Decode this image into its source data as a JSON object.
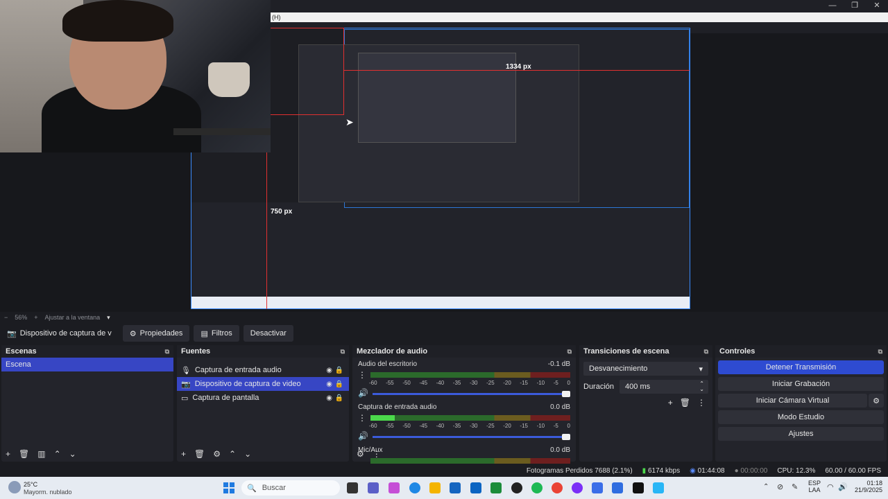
{
  "window": {
    "title_fragment": "(H)",
    "controls": [
      "—",
      "❐",
      "✕"
    ]
  },
  "preview": {
    "measure_h": "1334 px",
    "measure_v": "750 px"
  },
  "zoom": {
    "minus": "−",
    "percent": "56%",
    "plus": "+",
    "fit_label": "Ajustar a la ventana",
    "dropdown": "▾"
  },
  "source_toolbar": {
    "source_name": "Dispositivo de captura de v",
    "properties": "Propiedades",
    "filters": "Filtros",
    "deactivate": "Desactivar"
  },
  "scenes": {
    "title": "Escenas",
    "items": [
      "Escena"
    ]
  },
  "sources": {
    "title": "Fuentes",
    "items": [
      {
        "label": "Captura de entrada audio",
        "icon": "mic-icon"
      },
      {
        "label": "Dispositivo de captura de video",
        "icon": "camera-icon"
      },
      {
        "label": "Captura de pantalla",
        "icon": "monitor-icon"
      }
    ]
  },
  "mixer": {
    "title": "Mezclador de audio",
    "channels": [
      {
        "name": "Audio del escritorio",
        "db": "-0.1 dB",
        "level": 0
      },
      {
        "name": "Captura de entrada audio",
        "db": "0.0 dB",
        "level": 0.12
      },
      {
        "name": "Mic/Aux",
        "db": "0.0 dB",
        "level": 0
      }
    ],
    "scale": [
      "-60",
      "-55",
      "-50",
      "-45",
      "-40",
      "-35",
      "-30",
      "-25",
      "-20",
      "-15",
      "-10",
      "-5",
      "0"
    ]
  },
  "transitions": {
    "title": "Transiciones de escena",
    "selected": "Desvanecimiento",
    "duration_label": "Duración",
    "duration_value": "400 ms"
  },
  "controls": {
    "title": "Controles",
    "stop_stream": "Detener Transmisión",
    "start_recording": "Iniciar Grabación",
    "start_virtual_cam": "Iniciar Cámara Virtual",
    "studio_mode": "Modo Estudio",
    "settings": "Ajustes"
  },
  "status": {
    "dropped_frames": "Fotogramas Perdidos 7688 (2.1%)",
    "bitrate": "6174 kbps",
    "stream_time": "01:44:08",
    "rec_time": "00:00:00",
    "cpu": "CPU: 12.3%",
    "fps": "60.00 / 60.00 FPS"
  },
  "taskbar": {
    "weather_temp": "25°C",
    "weather_desc": "Mayorm. nublado",
    "search_placeholder": "Buscar",
    "lang_1": "ESP",
    "lang_2": "LAA",
    "time": "01:18",
    "date": "21/9/2025"
  },
  "colors": {
    "accent": "#3746c4",
    "primary_button": "#2e4bd1",
    "measure_line": "#e23030"
  }
}
